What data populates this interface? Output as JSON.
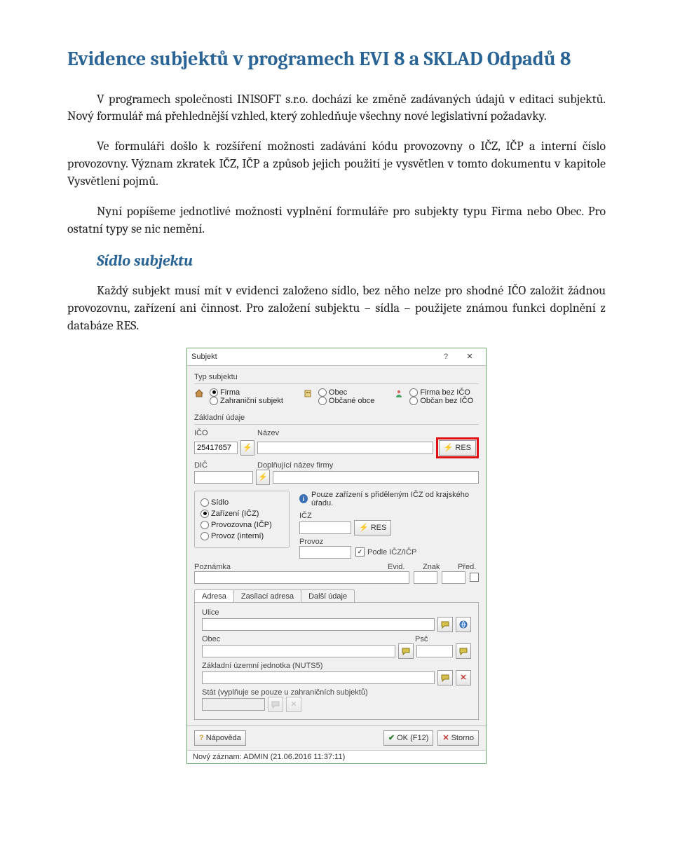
{
  "doc": {
    "title": "Evidence subjektů v programech EVI 8 a SKLAD Odpadů 8",
    "p1": "V programech společnosti INISOFT s.r.o. dochází ke změně zadávaných údajů v editaci subjektů. Nový formulář má přehlednější vzhled, který zohledňuje všechny nové legislativní požadavky.",
    "p2": "Ve formuláři došlo k rozšíření možnosti zadávání kódu provozovny o IČZ, IČP a interní číslo provozovny. Význam zkratek IČZ, IČP a způsob jejich použití je vysvětlen v tomto dokumentu v kapitole Vysvětlení pojmů.",
    "p3": "Nyní popíšeme jednotlivé možnosti vyplnění formuláře pro subjekty typu Firma nebo Obec. Pro ostatní typy se nic nemění.",
    "h2": "Sídlo subjektu",
    "p4": "Každý subjekt musí mít v evidenci založeno sídlo, bez něho nelze pro shodné IČO založit žádnou provozovnu, zařízení ani činnost. Pro založení subjektu – sídla – použijete známou funkci doplnění z databáze RES."
  },
  "dlg": {
    "title": "Subjekt",
    "help": "?",
    "typ_label": "Typ subjektu",
    "typ": [
      "Firma",
      "Zahraniční subjekt",
      "Obec",
      "Občané obce",
      "Firma bez IČO",
      "Občan bez IČO"
    ],
    "zaklad_label": "Základní údaje",
    "ico": {
      "label": "IČO",
      "value": "25417657"
    },
    "nazev": {
      "label": "Název",
      "value": ""
    },
    "res_btn": "RES",
    "dic": {
      "label": "DIČ",
      "value": ""
    },
    "dopl": {
      "label": "Doplňující název firmy",
      "value": ""
    },
    "loc": {
      "opts": [
        "Sídlo",
        "Zařízení (IČZ)",
        "Provozovna (IČP)",
        "Provoz (interní)"
      ],
      "selected": 1
    },
    "info": "Pouze zařízení s přiděleným IČZ od krajského úřadu.",
    "icz": {
      "label": "IČZ",
      "value": "",
      "res": "RES"
    },
    "provoz": {
      "label": "Provoz",
      "value": ""
    },
    "podle": {
      "label": "Podle IČZ/IČP",
      "checked": true
    },
    "pozn": {
      "label": "Poznámka",
      "value": ""
    },
    "evid": {
      "label": "Evid.",
      "value": ""
    },
    "znak": {
      "label": "Znak",
      "value": ""
    },
    "pred": {
      "label": "Před.",
      "checked": false
    },
    "tabs": [
      "Adresa",
      "Zasílací adresa",
      "Další údaje"
    ],
    "ulice": {
      "label": "Ulice",
      "value": ""
    },
    "obec": {
      "label": "Obec",
      "value": ""
    },
    "psc": {
      "label": "Psč",
      "value": ""
    },
    "zuj": {
      "label": "Základní územní jednotka (NUTS5)",
      "value": ""
    },
    "stat": {
      "label": "Stát (vyplňuje se pouze u zahraničních subjektů)",
      "value": ""
    },
    "buttons": {
      "help": "Nápověda",
      "ok": "OK (F12)",
      "cancel": "Storno"
    },
    "status": "Nový záznam: ADMIN (21.06.2016 11:37:11)"
  }
}
